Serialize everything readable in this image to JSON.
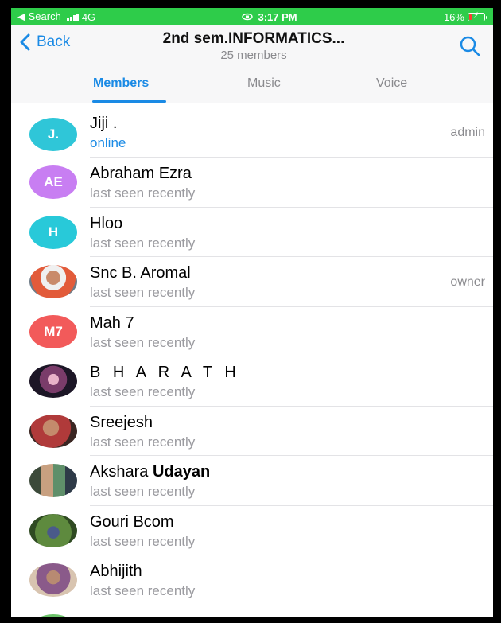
{
  "status_bar": {
    "back_label": "◀ Search",
    "network": "4G",
    "time": "3:17 PM",
    "battery": "16%",
    "battery_level": 0.16
  },
  "header": {
    "back_label": "Back",
    "title": "2nd sem.INFORMATICS...",
    "subtitle": "25 members"
  },
  "tabs": [
    {
      "label": "Members",
      "active": true
    },
    {
      "label": "Music",
      "active": false
    },
    {
      "label": "Voice",
      "active": false
    }
  ],
  "colors": {
    "accent": "#1a8ae5",
    "status_bar": "#2ecc4a"
  },
  "members": [
    {
      "initials": "J.",
      "name": "Jiji .",
      "status": "online",
      "role": "admin",
      "avatar_color": "#2fc6d8",
      "online": true
    },
    {
      "initials": "AE",
      "name": "Abraham Ezra",
      "status": "last seen recently",
      "role": "",
      "avatar_color": "#c87ef2"
    },
    {
      "initials": "H",
      "name": "Hloo",
      "status": "last seen recently",
      "role": "",
      "avatar_color": "#28c9d9"
    },
    {
      "initials": "",
      "name": "Snc B. Aromal",
      "status": "last seen recently",
      "role": "owner",
      "avatar_color": "#8c9aa3",
      "photo": true
    },
    {
      "initials": "M7",
      "name": "Mah 7",
      "status": "last seen recently",
      "role": "",
      "avatar_color": "#f25a5a"
    },
    {
      "initials": "",
      "name": "B H A R A T H",
      "status": "last seen recently",
      "role": "",
      "avatar_color": "#2a2035",
      "photo": true
    },
    {
      "initials": "",
      "name": "Sreejesh",
      "status": "last seen recently",
      "role": "",
      "avatar_color": "#6a3a2e",
      "photo": true
    },
    {
      "initials": "",
      "name_parts": [
        "Akshara ",
        "Udayan"
      ],
      "status": "last seen recently",
      "role": "",
      "avatar_color": "#4a7a5a",
      "photo": true
    },
    {
      "initials": "",
      "name": "Gouri Bcom",
      "status": "last seen recently",
      "role": "",
      "avatar_color": "#3d6b2e",
      "photo": true
    },
    {
      "initials": "",
      "name": "Abhijith",
      "status": "last seen recently",
      "role": "",
      "avatar_color": "#8a6a5a",
      "photo": true
    }
  ]
}
